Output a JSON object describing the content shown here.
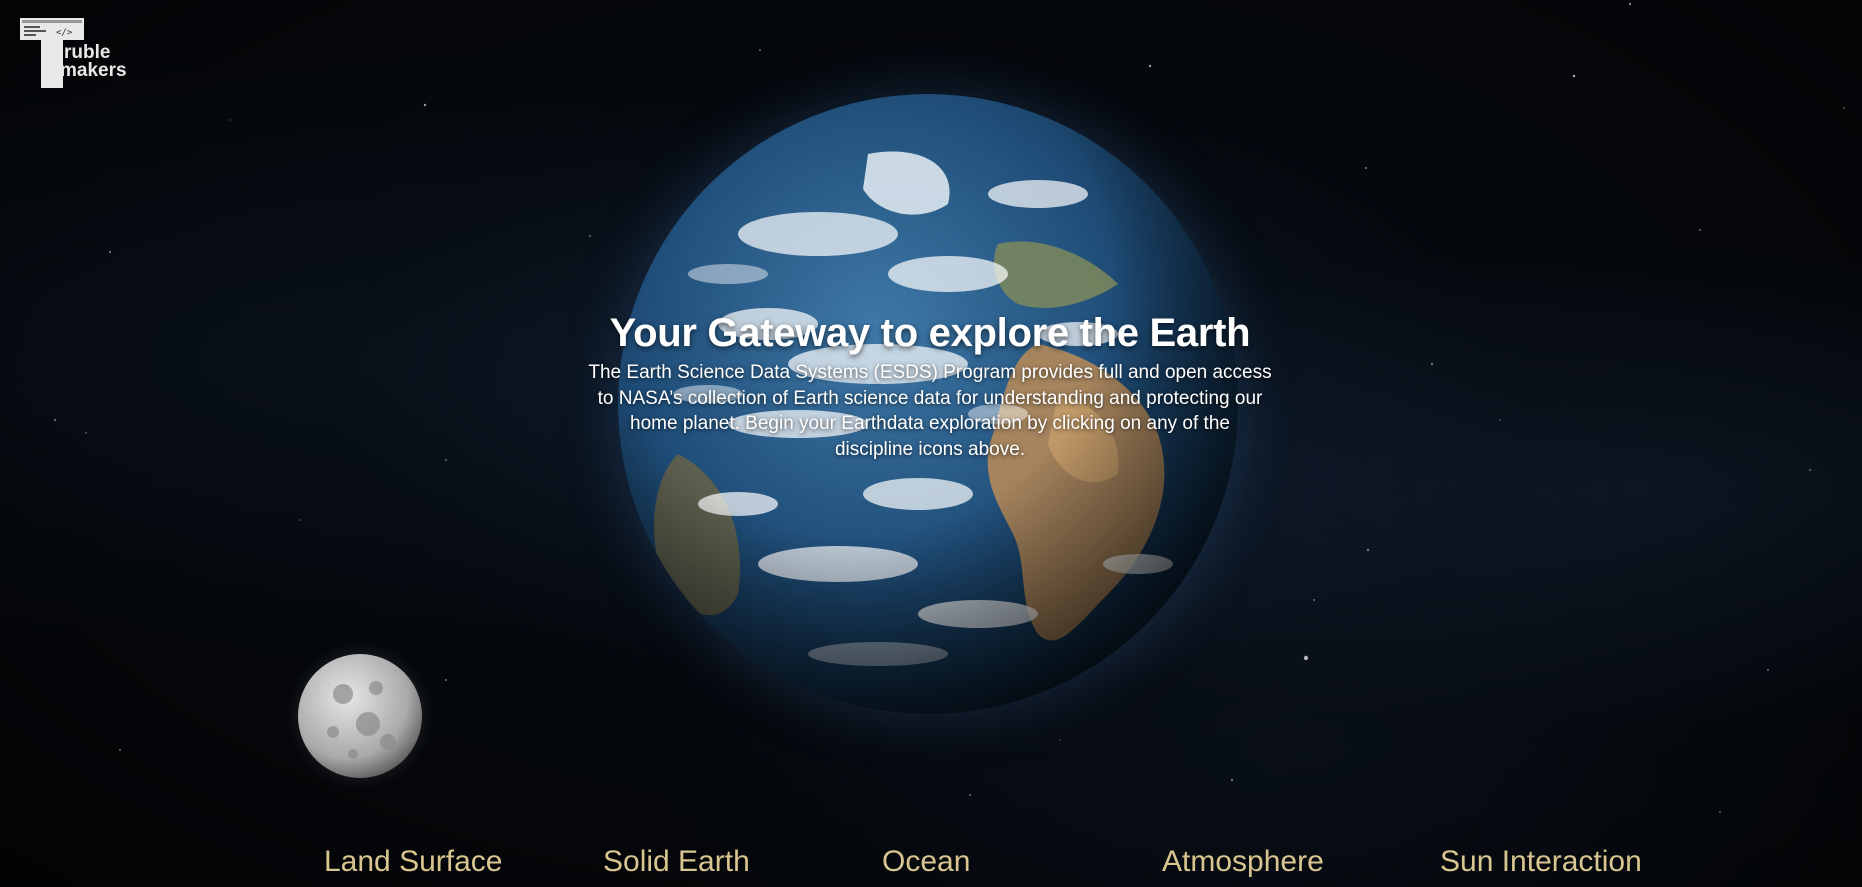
{
  "logo": {
    "text_line1": "ruble",
    "text_line2": "makers",
    "initial": "T",
    "alt": "Trouble makers logo"
  },
  "hero": {
    "title": "Your Gateway to explore the Earth",
    "description_lines": [
      "The Earth Science Data Systems (ESDS) Program provides full and open access",
      "to NASA’s collection of Earth science data for understanding and protecting our",
      "home planet. Begin your Earthdata exploration by clicking on any of the",
      "discipline icons above."
    ]
  },
  "disciplines": [
    {
      "label": "Land Surface"
    },
    {
      "label": "Solid Earth"
    },
    {
      "label": "Ocean"
    },
    {
      "label": "Atmosphere"
    },
    {
      "label": "Sun Interaction"
    }
  ],
  "colors": {
    "background": "#020304",
    "discipline_text": "#d9c58f",
    "hero_text": "#ffffff"
  }
}
